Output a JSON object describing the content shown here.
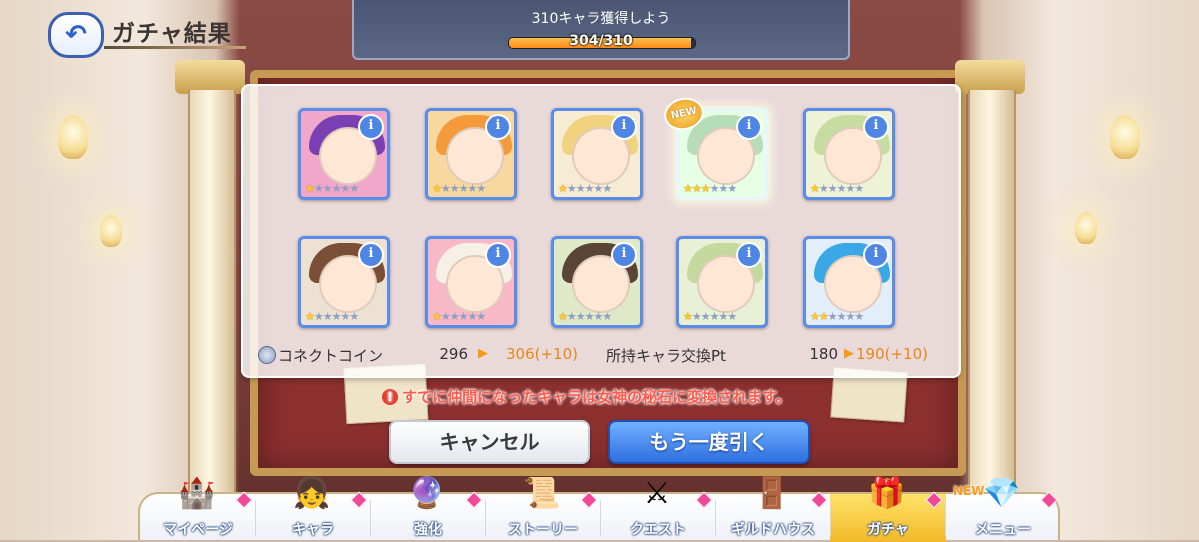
{
  "header": {
    "back_icon": "back-arrow-icon",
    "title": "ガチャ結果"
  },
  "mission": {
    "text": "310キャラ獲得しよう",
    "count": "304/310",
    "progress": 0.98
  },
  "results": {
    "cards": [
      {
        "hair": "#7a3fb2",
        "bg": "#f0a7c9",
        "stars": 1,
        "is_new": false
      },
      {
        "hair": "#f49a3a",
        "bg": "#f7d8a0",
        "stars": 1,
        "is_new": false
      },
      {
        "hair": "#f1d27e",
        "bg": "#f6ecd3",
        "stars": 1,
        "is_new": false
      },
      {
        "hair": "#b6dcb8",
        "bg": "#e7ffe5",
        "stars": 3,
        "is_new": true
      },
      {
        "hair": "#c7dca0",
        "bg": "#eef3d8",
        "stars": 1,
        "is_new": false
      },
      {
        "hair": "#7b4f35",
        "bg": "#ece1d2",
        "stars": 1,
        "is_new": false
      },
      {
        "hair": "#f6f0e6",
        "bg": "#f7b9c8",
        "stars": 1,
        "is_new": false
      },
      {
        "hair": "#5a4436",
        "bg": "#dfe8c7",
        "stars": 1,
        "is_new": false
      },
      {
        "hair": "#c5d89e",
        "bg": "#e8f0d6",
        "stars": 1,
        "is_new": false
      },
      {
        "hair": "#3aa7e6",
        "bg": "#e3eefb",
        "stars": 2,
        "is_new": false
      }
    ],
    "info_label": "i",
    "new_label": "NEW"
  },
  "stats": {
    "coin_icon": "coin-icon",
    "coin_label": "コネクトコイン",
    "coin_old": "296",
    "coin_new": "306(+10)",
    "pt_label": "所持キャラ交換Pt",
    "pt_old": "180",
    "pt_new": "190(+10)"
  },
  "notice": "すでに仲間になったキャラは女神の秘石に変換されます。",
  "buttons": {
    "cancel": "キャンセル",
    "retry": "もう一度引く"
  },
  "nav": {
    "items": [
      {
        "label": "マイページ",
        "icon": "castle-icon",
        "glyph": "🏰",
        "active": false,
        "new": false
      },
      {
        "label": "キャラ",
        "icon": "character-icon",
        "glyph": "👧",
        "active": false,
        "new": false
      },
      {
        "label": "強化",
        "icon": "enhance-icon",
        "glyph": "🔮",
        "active": false,
        "new": false
      },
      {
        "label": "ストーリー",
        "icon": "story-scroll-icon",
        "glyph": "📜",
        "active": false,
        "new": false
      },
      {
        "label": "クエスト",
        "icon": "quest-flag-icon",
        "glyph": "⚔",
        "active": false,
        "new": false
      },
      {
        "label": "ギルドハウス",
        "icon": "guildhouse-door-icon",
        "glyph": "🚪",
        "active": false,
        "new": false
      },
      {
        "label": "ガチャ",
        "icon": "gacha-icon",
        "glyph": "🎁",
        "active": true,
        "new": false
      },
      {
        "label": "メニュー",
        "icon": "menu-crystal-icon",
        "glyph": "💎",
        "active": false,
        "new": true
      }
    ],
    "new_label": "NEW"
  },
  "colors": {
    "accent_blue": "#2f6fe0",
    "bonus_orange": "#e8871a",
    "notice_red": "#ff5b4a"
  }
}
